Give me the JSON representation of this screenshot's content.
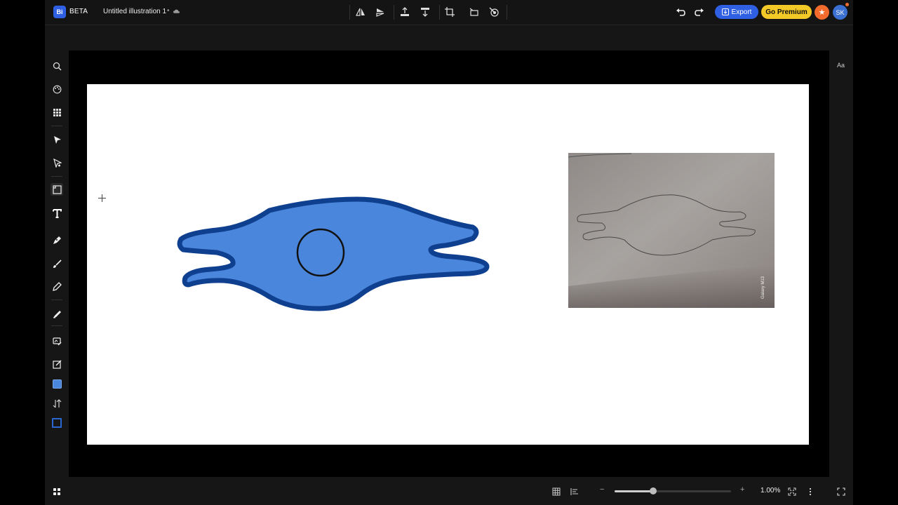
{
  "app": {
    "logo_text": "Bi",
    "badge": "BETA",
    "document_title": "Untitled illustration 1",
    "title_separator": "•"
  },
  "toolbar_icons": [
    "flip-horizontal-icon",
    "flip-vertical-icon",
    "bring-forward-icon",
    "send-backward-icon",
    "crop-icon",
    "transform-icon",
    "magic-edit-icon"
  ],
  "history": {
    "undo": "undo-icon",
    "redo": "redo-icon"
  },
  "actions": {
    "export_label": "Export",
    "premium_label": "Go Premium",
    "avatar_initials": "SK"
  },
  "left_tools": [
    "search-icon",
    "palette-icon",
    "apps-grid-icon",
    "select-arrow-icon",
    "direct-select-icon",
    "frame-icon",
    "text-icon",
    "pen-icon",
    "brush-icon",
    "pencil-icon",
    "marker-icon",
    "image-edit-icon",
    "edit-icon",
    "fill-swatch-icon",
    "swap-icon",
    "stroke-swatch-icon"
  ],
  "right_panel": {
    "font_label": "Aa"
  },
  "canvas": {
    "photo_watermark": "Galaxy M13"
  },
  "colors": {
    "accent": "#2f5fe3",
    "premium": "#f3c927",
    "shape_fill": "#4a86db",
    "shape_stroke": "#0f3f8f",
    "avatar": "#3b6fd1"
  },
  "zoom": {
    "label": "1.00%",
    "level": 0.33,
    "minus": "−",
    "plus": "+"
  },
  "bottom_icons": [
    "grid-view-icon",
    "layers-icon",
    "fit-screen-icon",
    "more-options-icon",
    "fullscreen-icon"
  ]
}
